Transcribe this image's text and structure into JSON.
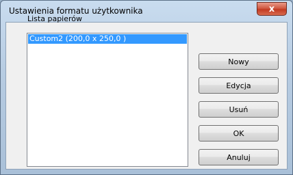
{
  "window": {
    "title": "Ustawienia formatu użytkownika"
  },
  "close_button": {
    "glyph": "x",
    "icon": "close-icon"
  },
  "paper_list": {
    "label": "Lista papierów",
    "items": [
      {
        "label": "Custom2 (200,0 x 250,0 )",
        "selected": true
      }
    ]
  },
  "buttons": {
    "new": "Nowy",
    "edit": "Edycja",
    "delete": "Usuń",
    "ok": "OK",
    "cancel": "Anuluj"
  },
  "colors": {
    "selection": "#3399ff",
    "close_button": "#c23a23"
  }
}
